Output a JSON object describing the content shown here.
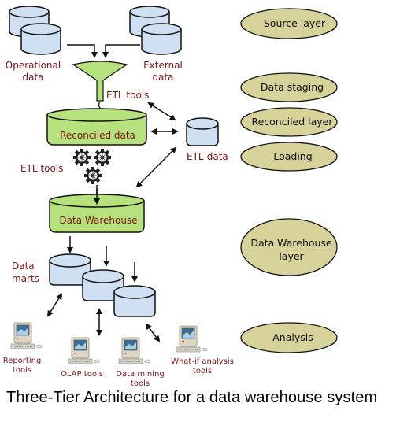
{
  "title": "Three-Tier Architecture for a data warehouse system",
  "colors": {
    "label_text": "#7b1416",
    "source_cylinder_fill": "#cfe0f3",
    "green_store_fill": "#b5e27c",
    "layer_ellipse_fill": "#d6d29a",
    "outline": "#111111"
  },
  "left_column": {
    "sources": {
      "operational_label_line1": "Operational",
      "operational_label_line2": "data",
      "external_label_line1": "External",
      "external_label_line2": "data"
    },
    "etl_tools_top": "ETL tools",
    "reconciled_data": "Reconciled data",
    "etl_tools_mid": "ETL tools",
    "etl_data": "ETL-data",
    "data_warehouse": "Data Warehouse",
    "data_marts_line1": "Data",
    "data_marts_line2": "marts",
    "tools": [
      {
        "line1": "Reporting",
        "line2": "tools"
      },
      {
        "line1": "OLAP tools",
        "line2": ""
      },
      {
        "line1": "Data mining",
        "line2": "tools"
      },
      {
        "line1": "What-if analysis",
        "line2": "tools"
      }
    ]
  },
  "layers": [
    {
      "label": "Source layer"
    },
    {
      "label": "Data staging"
    },
    {
      "label": "Reconciled layer"
    },
    {
      "label": "Loading"
    },
    {
      "label_line1": "Data Warehouse",
      "label_line2": "layer"
    },
    {
      "label": "Analysis"
    }
  ]
}
